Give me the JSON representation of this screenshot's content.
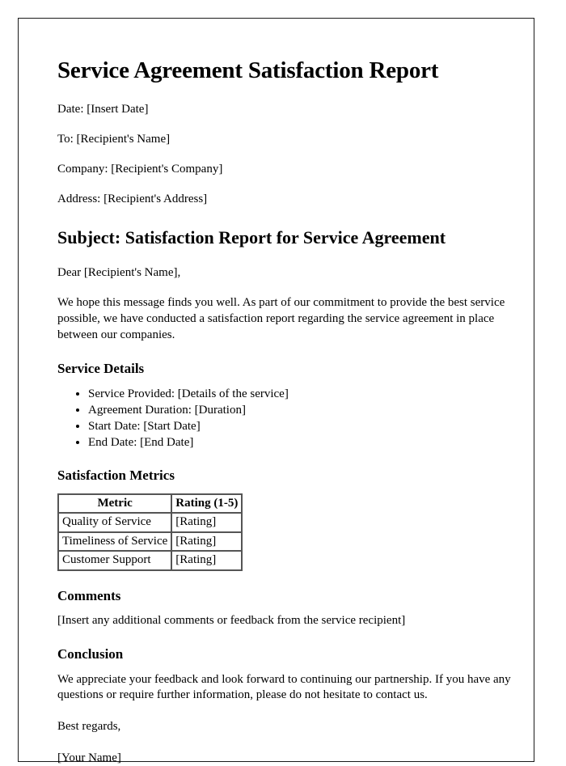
{
  "document": {
    "title": "Service Agreement Satisfaction Report",
    "meta": {
      "date": "Date: [Insert Date]",
      "to": "To: [Recipient's Name]",
      "company": "Company: [Recipient's Company]",
      "address": "Address: [Recipient's Address]"
    },
    "subject_heading": "Subject: Satisfaction Report for Service Agreement",
    "salutation": "Dear [Recipient's Name],",
    "intro_paragraph": "We hope this message finds you well. As part of our commitment to provide the best service possible, we have conducted a satisfaction report regarding the service agreement in place between our companies.",
    "service_details": {
      "heading": "Service Details",
      "items": [
        "Service Provided: [Details of the service]",
        "Agreement Duration: [Duration]",
        "Start Date: [Start Date]",
        "End Date: [End Date]"
      ]
    },
    "satisfaction_metrics": {
      "heading": "Satisfaction Metrics",
      "columns": [
        "Metric",
        "Rating (1-5)"
      ],
      "rows": [
        [
          "Quality of Service",
          "[Rating]"
        ],
        [
          "Timeliness of Service",
          "[Rating]"
        ],
        [
          "Customer Support",
          "[Rating]"
        ]
      ]
    },
    "comments": {
      "heading": "Comments",
      "text": "[Insert any additional comments or feedback from the service recipient]"
    },
    "conclusion": {
      "heading": "Conclusion",
      "text": "We appreciate your feedback and look forward to continuing our partnership. If you have any questions or require further information, please do not hesitate to contact us."
    },
    "closing": "Best regards,",
    "signature": "[Your Name]"
  }
}
